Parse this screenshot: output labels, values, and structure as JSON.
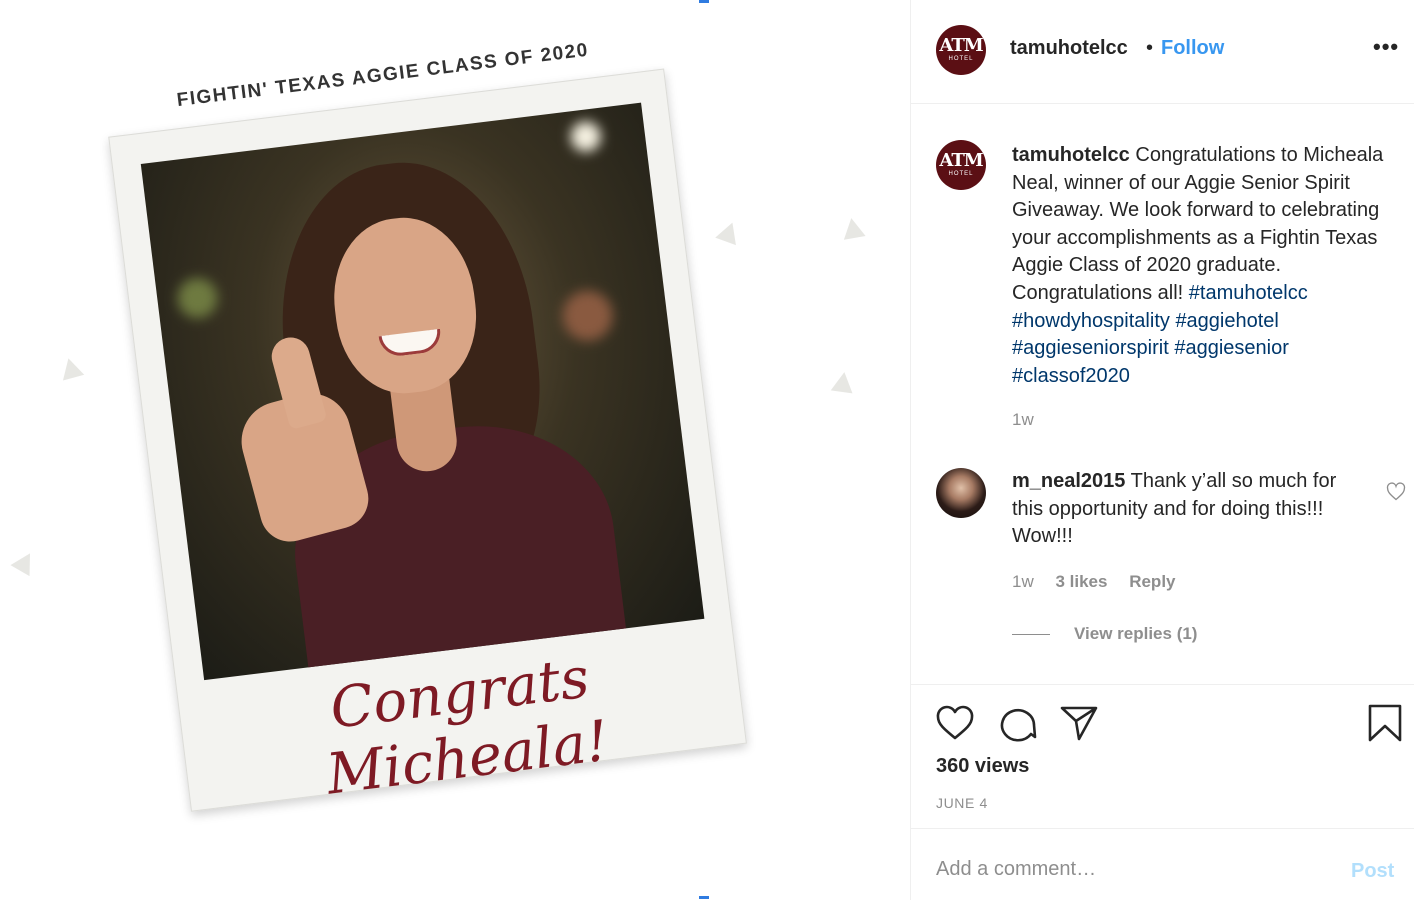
{
  "media": {
    "banner_text": "FIGHTIN' TEXAS AGGIE CLASS OF 2020",
    "overlay_text": "Congrats Micheala!"
  },
  "header": {
    "avatar_text": "ATM",
    "avatar_subtext": "HOTEL",
    "username": "tamuhotelcc",
    "separator": "•",
    "follow_label": "Follow",
    "more_label": "•••"
  },
  "caption": {
    "username": "tamuhotelcc",
    "text": "Congratulations to Micheala Neal, winner of our Aggie Senior Spirit Giveaway. We look forward to celebrating your accomplishments as a Fightin Texas Aggie Class of 2020 graduate. Congratulations all!",
    "hashtags": [
      "#tamuhotelcc",
      "#howdyhospitality",
      "#aggiehotel",
      "#aggieseniorspirit",
      "#aggiesenior",
      "#classof2020"
    ],
    "time": "1w"
  },
  "comment": {
    "username": "m_neal2015",
    "text": "Thank y’all so much for this opportunity and for doing this!!! Wow!!!",
    "time": "1w",
    "likes": "3 likes",
    "reply_label": "Reply",
    "view_replies": "View replies (1)"
  },
  "actions": {
    "icons": [
      "heart-icon",
      "comment-icon",
      "share-icon",
      "bookmark-icon"
    ],
    "views": "360 views",
    "date": "JUNE 4"
  },
  "add_comment": {
    "placeholder": "Add a comment…",
    "post_label": "Post"
  },
  "colors": {
    "link_blue": "#3897f0",
    "hashtag_blue": "#00376b",
    "maroon": "#5b0f14",
    "muted": "#8e8e8e"
  }
}
